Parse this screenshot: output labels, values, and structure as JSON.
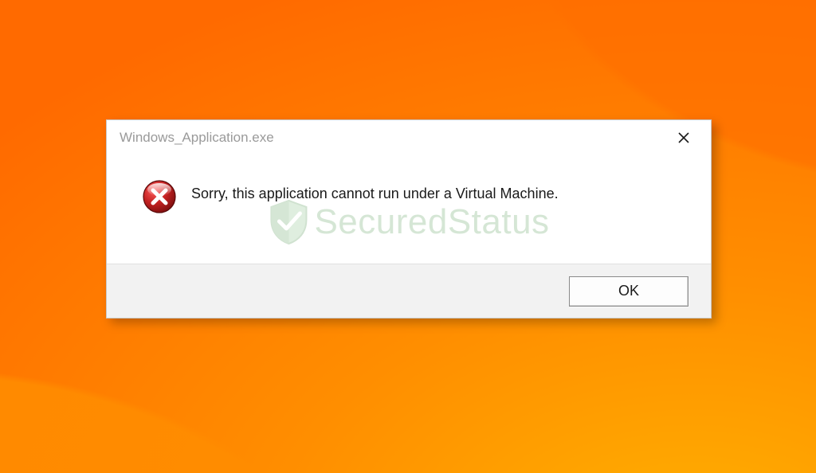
{
  "dialog": {
    "title": "Windows_Application.exe",
    "message": "Sorry, this application cannot run under a Virtual Machine.",
    "ok_label": "OK",
    "icon": "error-icon"
  },
  "watermark": {
    "text": "SecuredStatus"
  },
  "colors": {
    "background_start": "#ff6a00",
    "background_end": "#ffb300",
    "dialog_bg": "#ffffff",
    "footer_bg": "#f2f2f2",
    "title_text": "#9a9a9a",
    "error_red": "#c22121",
    "error_red_dark": "#7e0f0f",
    "watermark_green": "#6aa96a"
  }
}
